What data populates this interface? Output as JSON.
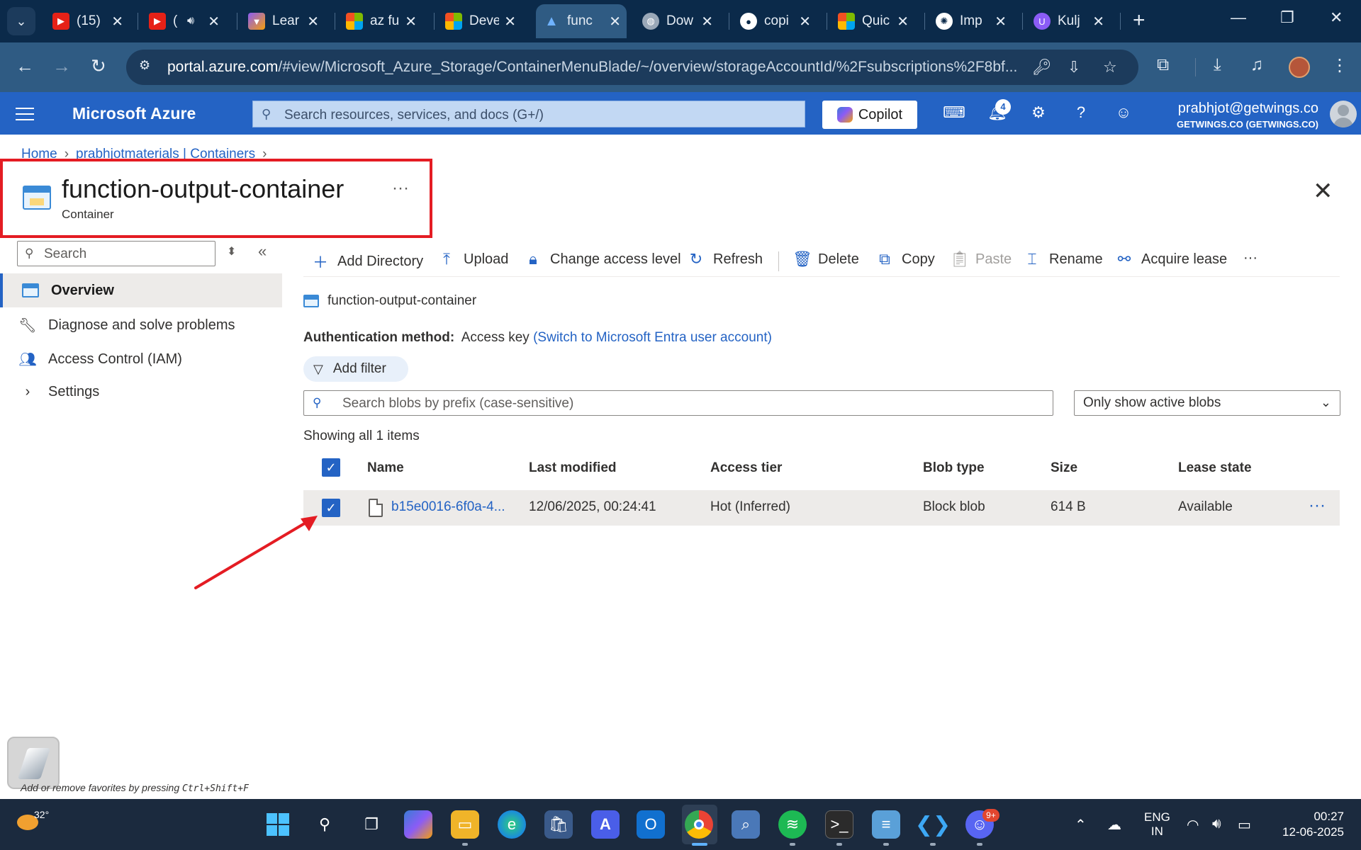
{
  "browser": {
    "tabs": [
      {
        "title": "(15)",
        "icon": "youtube-icon",
        "color": "#e62117"
      },
      {
        "title": "(",
        "icon": "youtube-icon",
        "color": "#e62117",
        "audio": true
      },
      {
        "title": "Lear",
        "icon": "vite-icon",
        "color": "#8b5cf6"
      },
      {
        "title": "az fu",
        "icon": "microsoft-icon",
        "color": "#f25022"
      },
      {
        "title": "Deve",
        "icon": "microsoft-icon",
        "color": "#f25022"
      },
      {
        "title": "func",
        "icon": "azure-icon",
        "color": "#3a8ad6",
        "active": true
      },
      {
        "title": "Dow",
        "icon": "globe-icon",
        "color": "#9aa8b8"
      },
      {
        "title": "copi",
        "icon": "github-icon",
        "color": "#ffffff"
      },
      {
        "title": "Quic",
        "icon": "microsoft-icon",
        "color": "#f25022"
      },
      {
        "title": "Imp",
        "icon": "openai-icon",
        "color": "#ffffff"
      },
      {
        "title": "Kulj",
        "icon": "ucoder-icon",
        "color": "#8b5cf6"
      }
    ],
    "url_host": "portal.azure.com",
    "url_path": "/#view/Microsoft_Azure_Storage/ContainerMenuBlade/~/overview/storageAccountId/%2Fsubscriptions%2F8bf..."
  },
  "azure": {
    "brand": "Microsoft Azure",
    "search_placeholder": "Search resources, services, and docs (G+/)",
    "copilot_label": "Copilot",
    "notification_count": "4",
    "account_email": "prabhjot@getwings.co",
    "account_directory": "GETWINGS.CO (GETWINGS.CO)"
  },
  "breadcrumb": {
    "home": "Home",
    "parent": "prabhjotmaterials | Containers"
  },
  "page": {
    "title": "function-output-container",
    "subtitle": "Container",
    "more": "···"
  },
  "sidebar": {
    "search_placeholder": "Search",
    "items": [
      {
        "label": "Overview",
        "icon": "container-icon",
        "active": true
      },
      {
        "label": "Diagnose and solve problems",
        "icon": "wrench-icon"
      },
      {
        "label": "Access Control (IAM)",
        "icon": "people-icon"
      },
      {
        "label": "Settings",
        "icon": "chevron-right-icon"
      }
    ]
  },
  "toolbar": {
    "add_directory": "Add Directory",
    "upload": "Upload",
    "change_access": "Change access level",
    "refresh": "Refresh",
    "delete": "Delete",
    "copy": "Copy",
    "paste": "Paste",
    "rename": "Rename",
    "acquire_lease": "Acquire lease",
    "more": "···"
  },
  "content": {
    "path": "function-output-container",
    "auth_label": "Authentication method:",
    "auth_value": "Access key",
    "auth_switch": "(Switch to Microsoft Entra user account)",
    "add_filter": "Add filter",
    "blob_search_placeholder": "Search blobs by prefix (case-sensitive)",
    "blob_filter_selected": "Only show active blobs",
    "showing": "Showing all 1 items"
  },
  "table": {
    "columns": [
      "Name",
      "Last modified",
      "Access tier",
      "Blob type",
      "Size",
      "Lease state"
    ],
    "rows": [
      {
        "name": "b15e0016-6f0a-4...",
        "last_modified": "12/06/2025, 00:24:41",
        "access_tier": "Hot (Inferred)",
        "blob_type": "Block blob",
        "size": "614 B",
        "lease_state": "Available",
        "checked": true
      }
    ]
  },
  "favorites_hint": {
    "text": "Add or remove favorites by pressing ",
    "shortcut": "Ctrl+Shift+F"
  },
  "taskbar": {
    "temperature": "32°",
    "lang_line1": "ENG",
    "lang_line2": "IN",
    "time": "00:27",
    "date": "12-06-2025",
    "discord_badge": "9+"
  },
  "colors": {
    "azure_blue": "#2463c4",
    "annotation_red": "#e41c23"
  }
}
